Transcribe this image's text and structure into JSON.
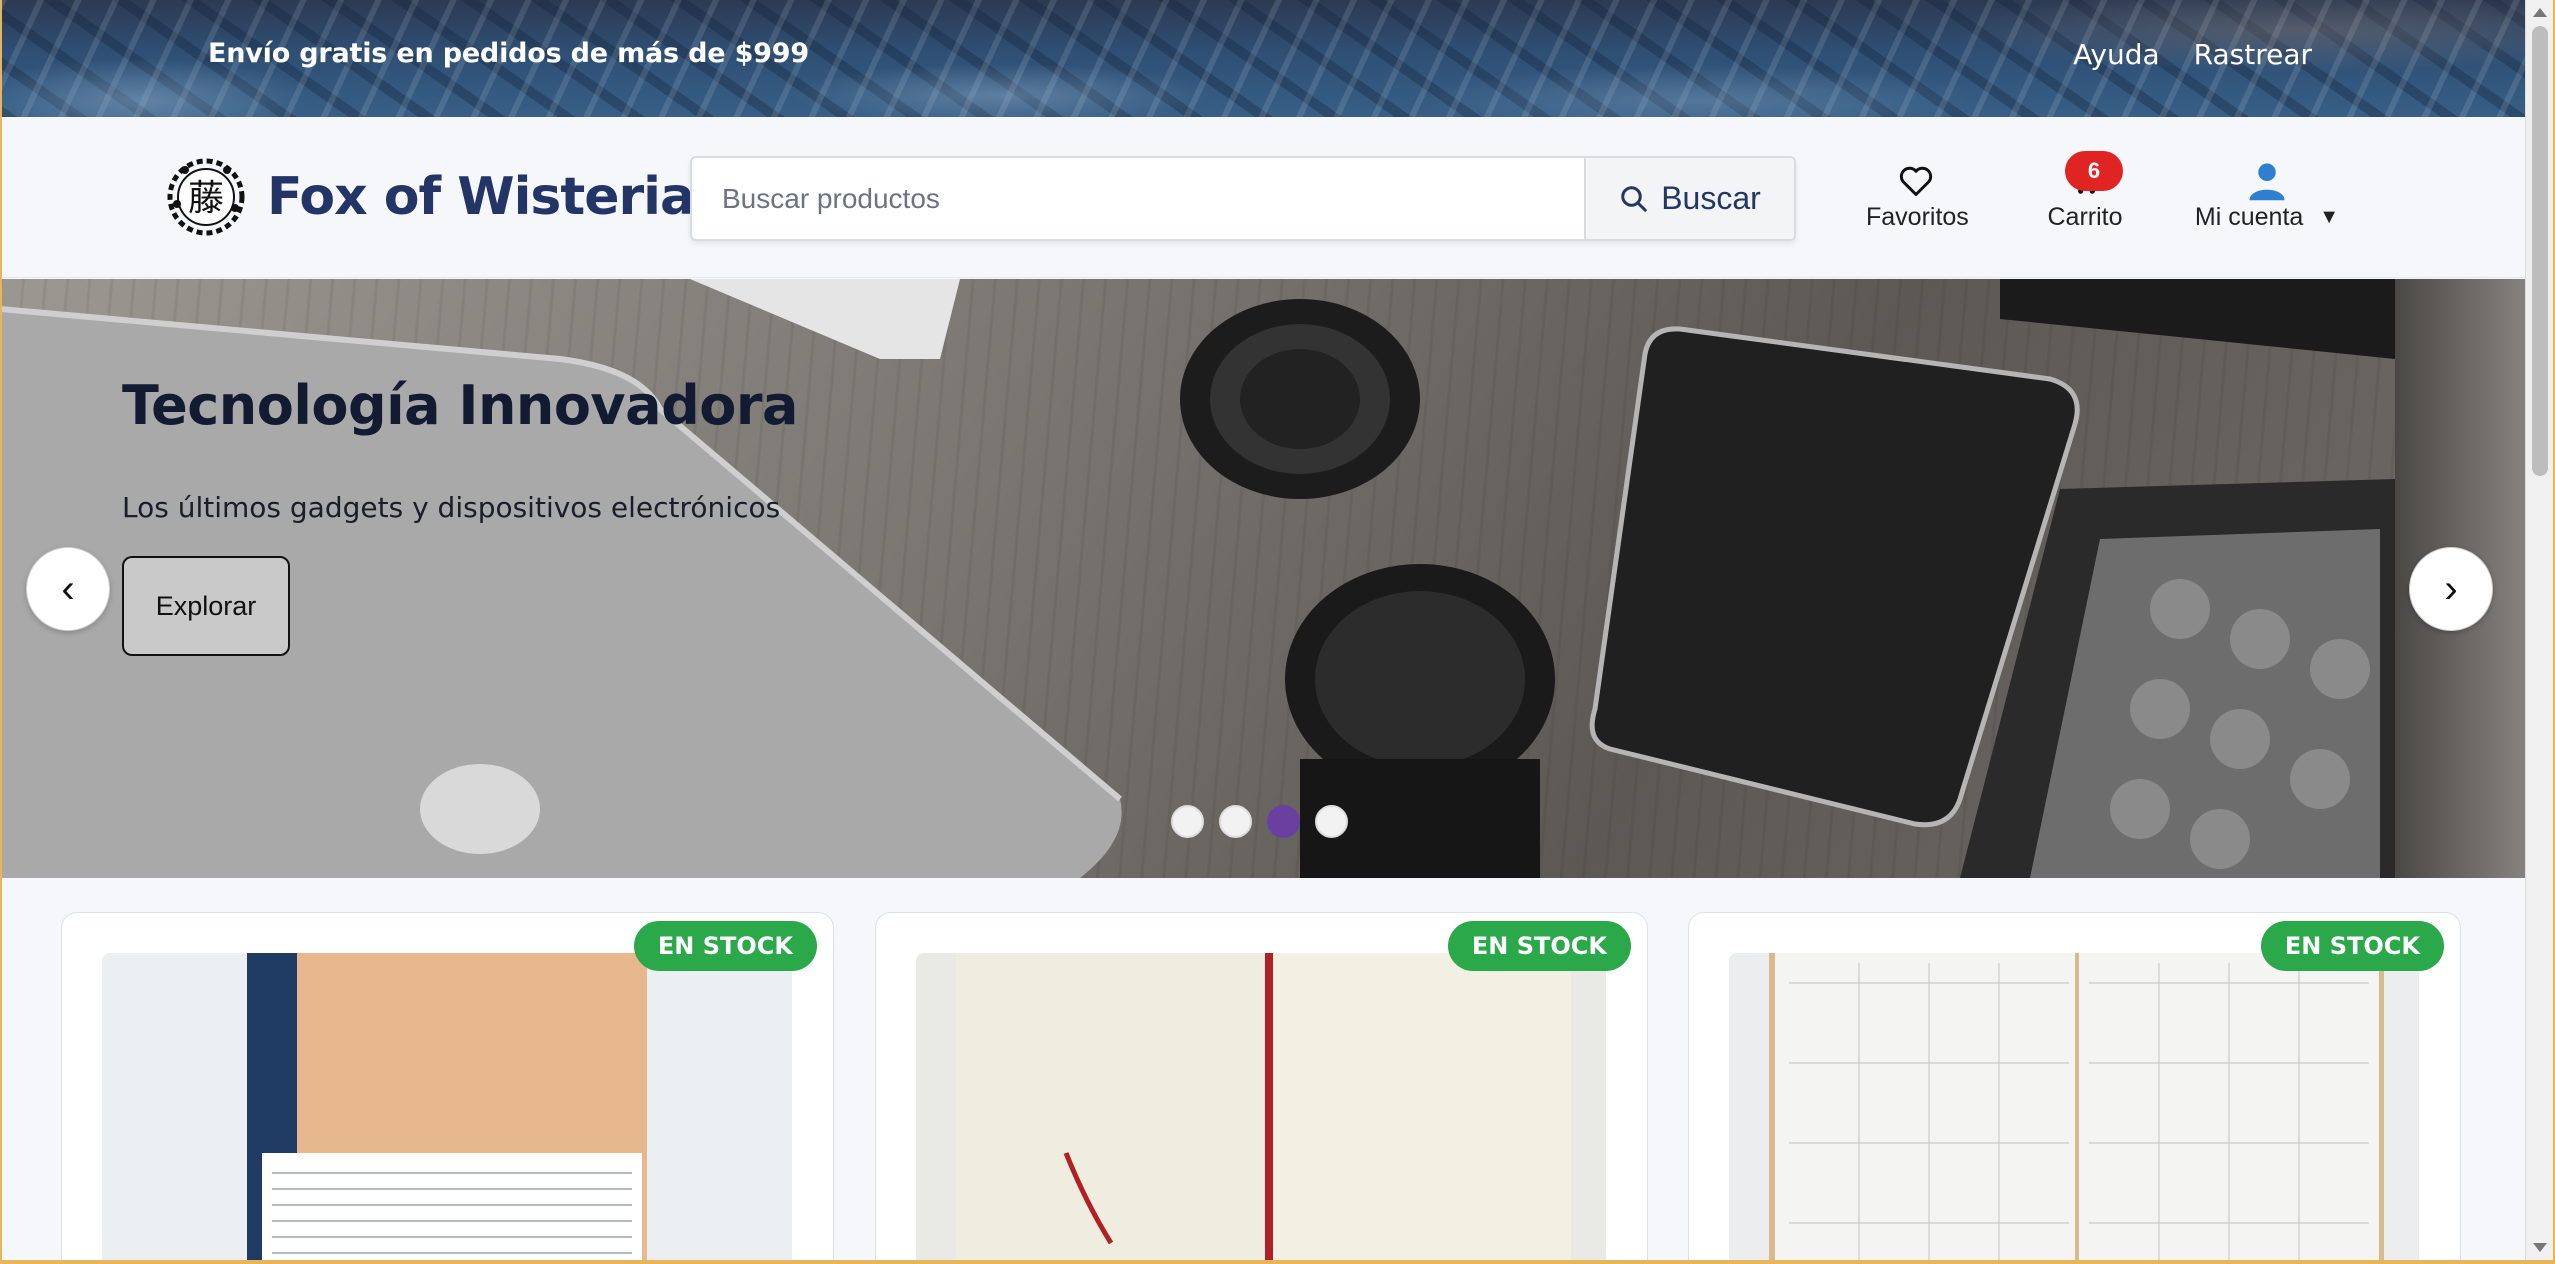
{
  "topbar": {
    "promo": "Envío gratis en pedidos de más de $999",
    "links": [
      "Ayuda",
      "Rastrear"
    ]
  },
  "header": {
    "brand": "Fox of Wisteria",
    "logo_glyph": "藤",
    "search_placeholder": "Buscar productos",
    "search_button": "Buscar",
    "favorites": "Favoritos",
    "cart": "Carrito",
    "cart_count": "6",
    "account": "Mi cuenta",
    "icons": {
      "search": "search-icon",
      "favorites": "heart-icon",
      "cart": "cart-icon",
      "account": "user-icon",
      "account_menu": "caret-down-icon"
    }
  },
  "hero": {
    "title": "Tecnología Innovadora",
    "subtitle": "Los últimos gadgets y dispositivos electrónicos",
    "cta": "Explorar",
    "prev": "‹",
    "next": "›",
    "slides": 4,
    "active_slide": 3
  },
  "products": {
    "cards": [
      {
        "status": "EN STOCK",
        "image": "notebook-kraft"
      },
      {
        "status": "EN STOCK",
        "image": "notebook-open-bookmark"
      },
      {
        "status": "EN STOCK",
        "image": "planner-grid"
      }
    ]
  },
  "colors": {
    "brand": "#233566",
    "badge_red": "#e02424",
    "stock_green": "#2aa84a",
    "active_dot": "#6b3fa0"
  }
}
